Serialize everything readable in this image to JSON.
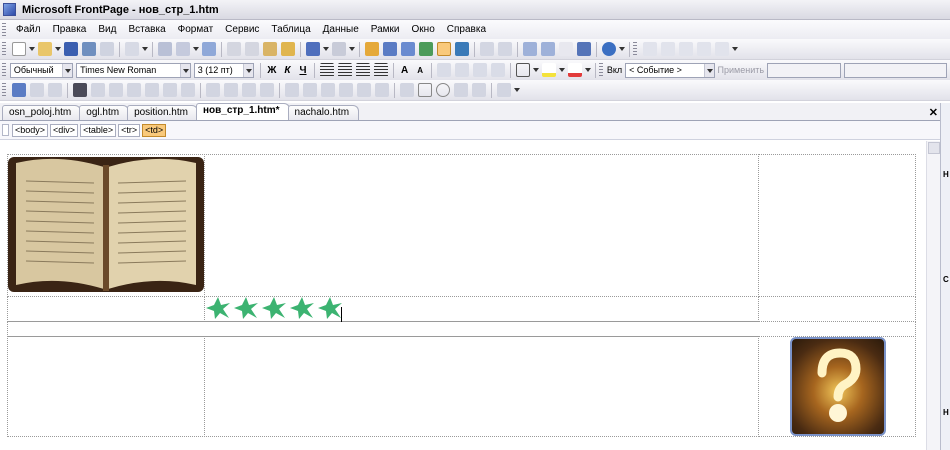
{
  "window": {
    "title": "Microsoft FrontPage - нов_стр_1.htm"
  },
  "menu": [
    "Файл",
    "Правка",
    "Вид",
    "Вставка",
    "Формат",
    "Сервис",
    "Таблица",
    "Данные",
    "Рамки",
    "Окно",
    "Справка"
  ],
  "format_toolbar": {
    "style": "Обычный",
    "font": "Times New Roman",
    "size": "3 (12 пт)",
    "bold": "Ж",
    "italic": "К",
    "underline": "Ч",
    "behaviors_label": "Вкл",
    "event": "< Событие >",
    "apply": "Применить"
  },
  "tabs": [
    "osn_poloj.htm",
    "ogl.htm",
    "position.htm",
    "нов_стр_1.htm*",
    "nachalo.htm"
  ],
  "active_tab_index": 3,
  "tag_selector": [
    "<body>",
    "<div>",
    "<table>",
    "<tr>",
    "<td>"
  ],
  "selected_tag": "<td>",
  "right_panel_letters": [
    "Н",
    "С",
    "Н"
  ],
  "colors": {
    "accent": "#f9c97b",
    "border": "#9ea3b6",
    "star_green": "#3cb371"
  }
}
